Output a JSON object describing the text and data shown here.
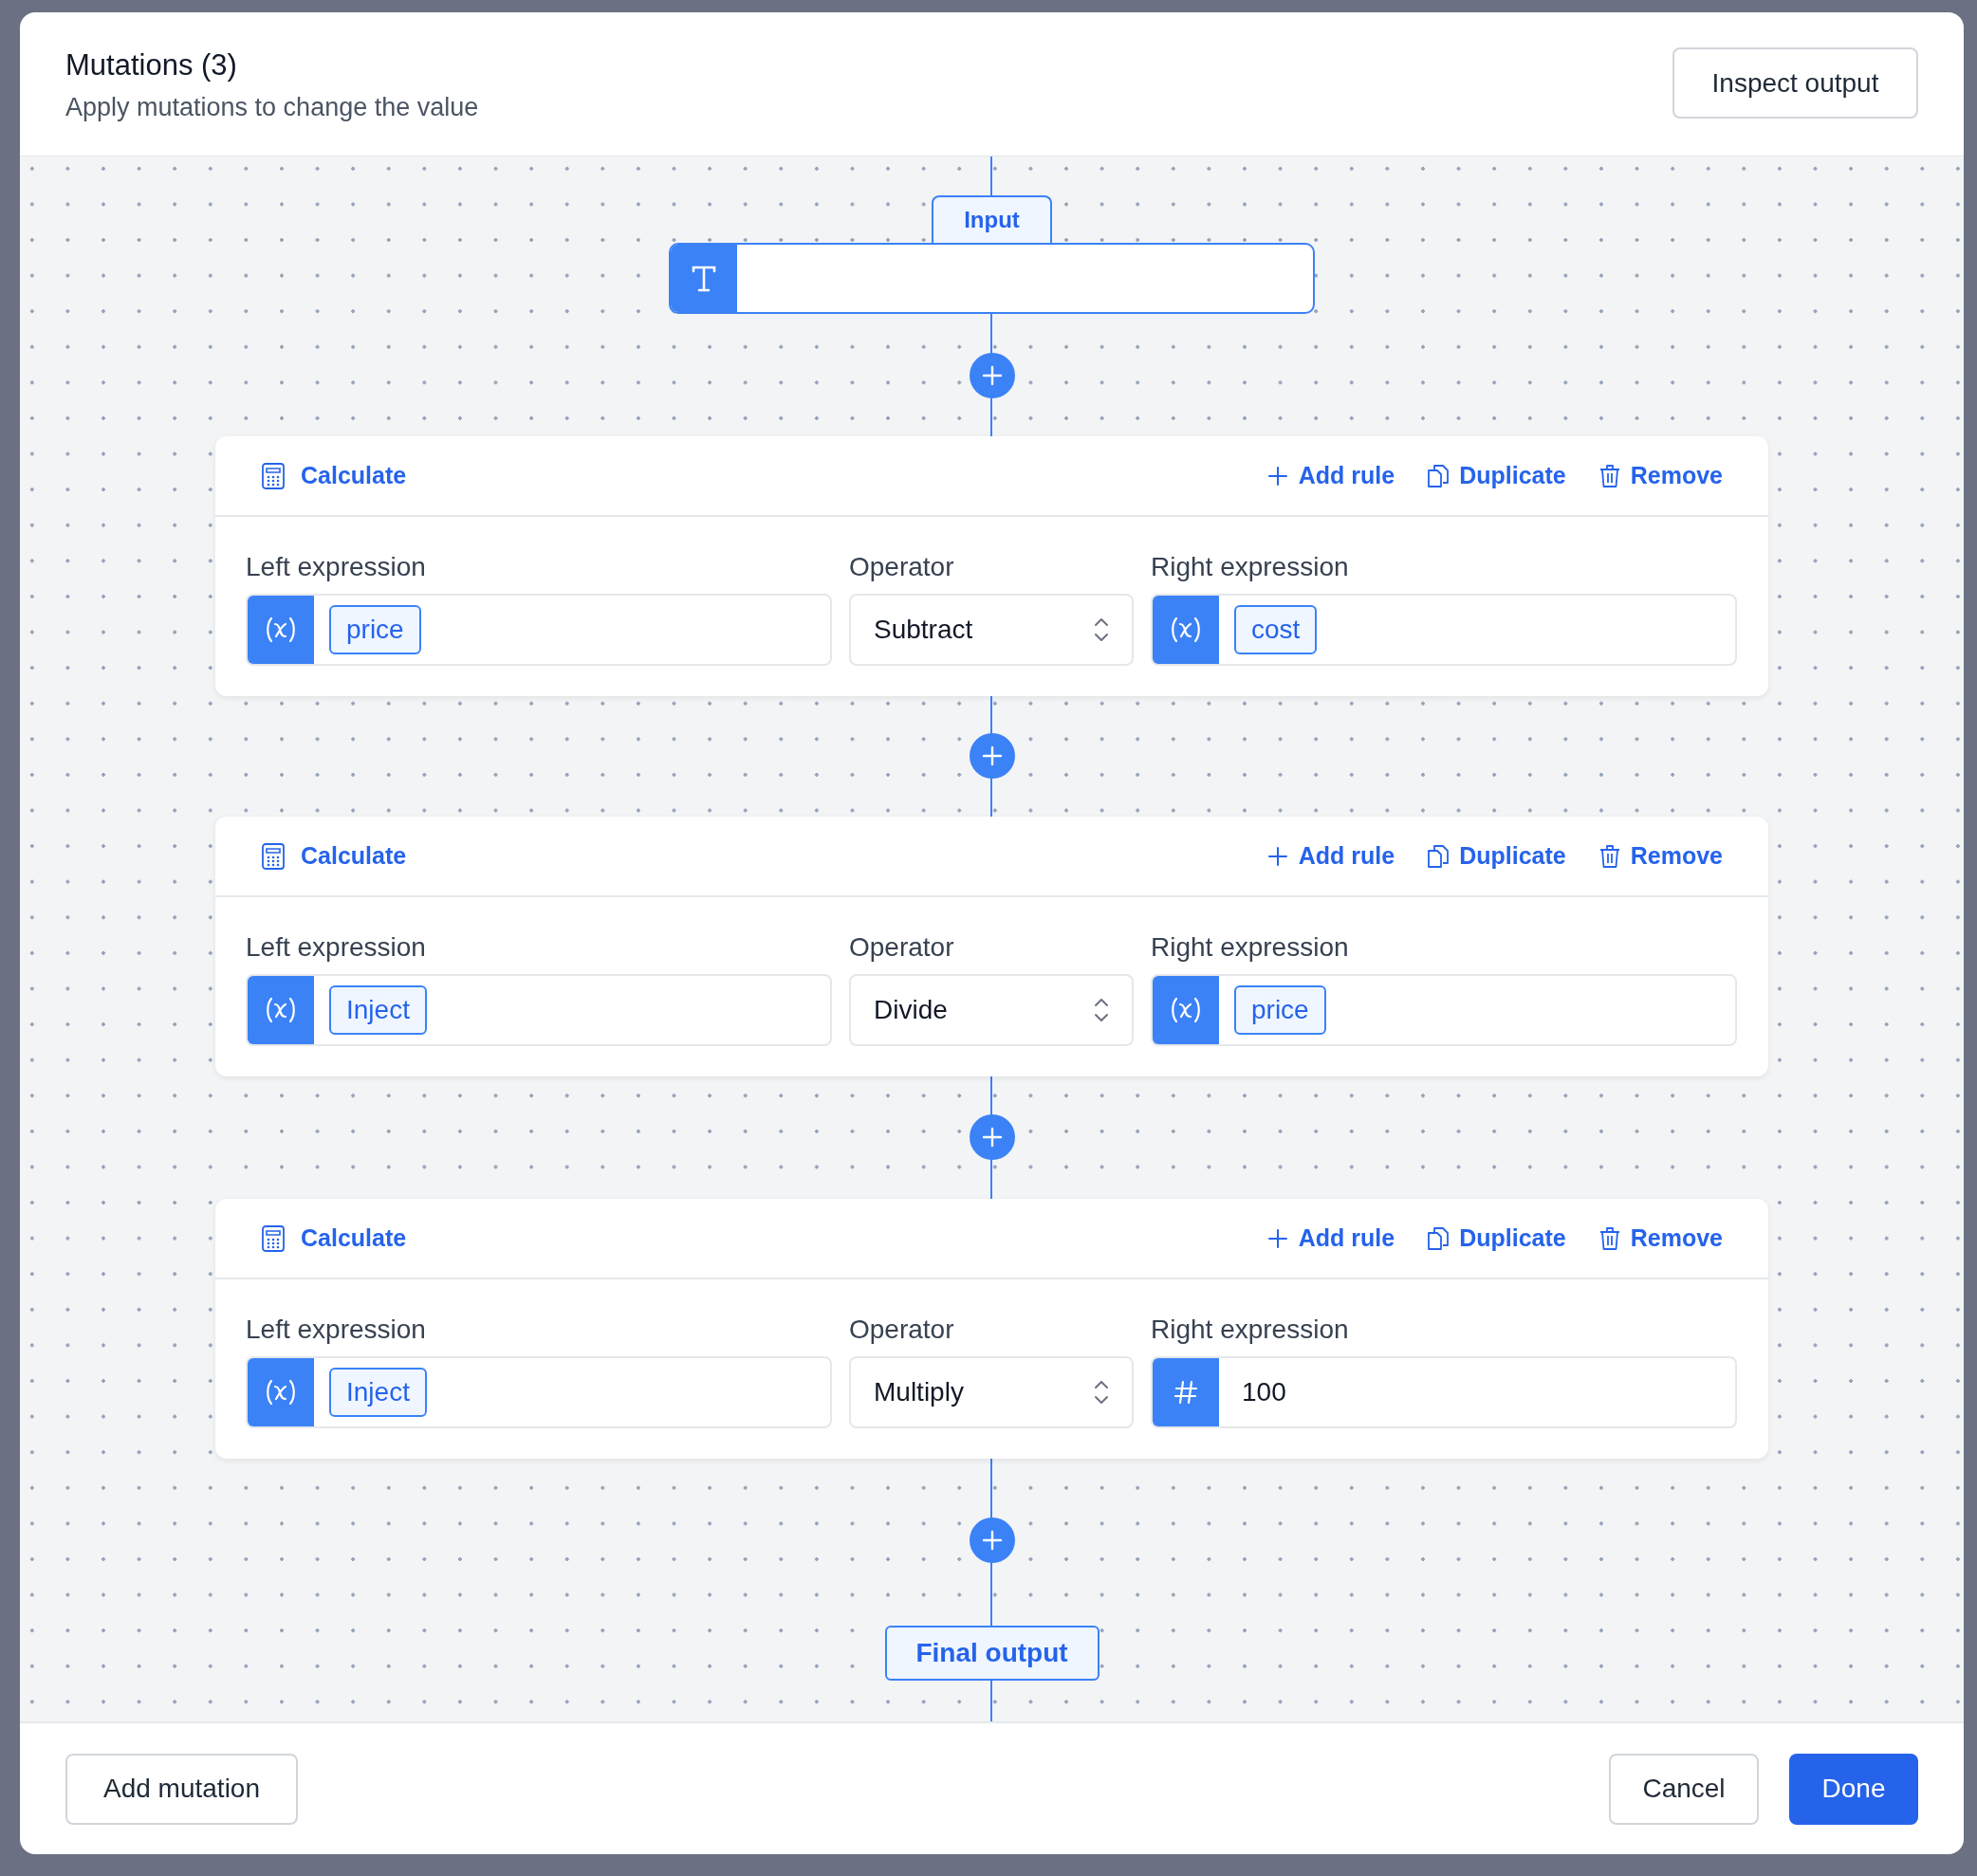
{
  "dialog": {
    "title": "Mutations (3)",
    "subtitle": "Apply mutations to change the value",
    "inspect_button": "Inspect output"
  },
  "input": {
    "label": "Input"
  },
  "mutations": [
    {
      "title": "Calculate",
      "actions": [
        {
          "kind": "add",
          "label": "Add rule"
        },
        {
          "kind": "duplicate",
          "label": "Duplicate"
        },
        {
          "kind": "remove",
          "label": "Remove"
        }
      ],
      "left": {
        "label": "Left expression",
        "kind": "variable",
        "value": "price"
      },
      "operator": {
        "label": "Operator",
        "value": "Subtract"
      },
      "right": {
        "label": "Right expression",
        "kind": "variable",
        "value": "cost"
      }
    },
    {
      "title": "Calculate",
      "actions": [
        {
          "kind": "add",
          "label": "Add rule"
        },
        {
          "kind": "duplicate",
          "label": "Duplicate"
        },
        {
          "kind": "remove",
          "label": "Remove"
        }
      ],
      "left": {
        "label": "Left expression",
        "kind": "variable",
        "value": "Inject"
      },
      "operator": {
        "label": "Operator",
        "value": "Divide"
      },
      "right": {
        "label": "Right expression",
        "kind": "variable",
        "value": "price"
      }
    },
    {
      "title": "Calculate",
      "actions": [
        {
          "kind": "add",
          "label": "Add rule"
        },
        {
          "kind": "duplicate",
          "label": "Duplicate"
        },
        {
          "kind": "remove",
          "label": "Remove"
        }
      ],
      "left": {
        "label": "Left expression",
        "kind": "variable",
        "value": "Inject"
      },
      "operator": {
        "label": "Operator",
        "value": "Multiply"
      },
      "right": {
        "label": "Right expression",
        "kind": "number",
        "value": "100"
      }
    }
  ],
  "final_output": "Final output",
  "footer": {
    "add_button": "Add mutation",
    "cancel_button": "Cancel",
    "done_button": "Done"
  }
}
